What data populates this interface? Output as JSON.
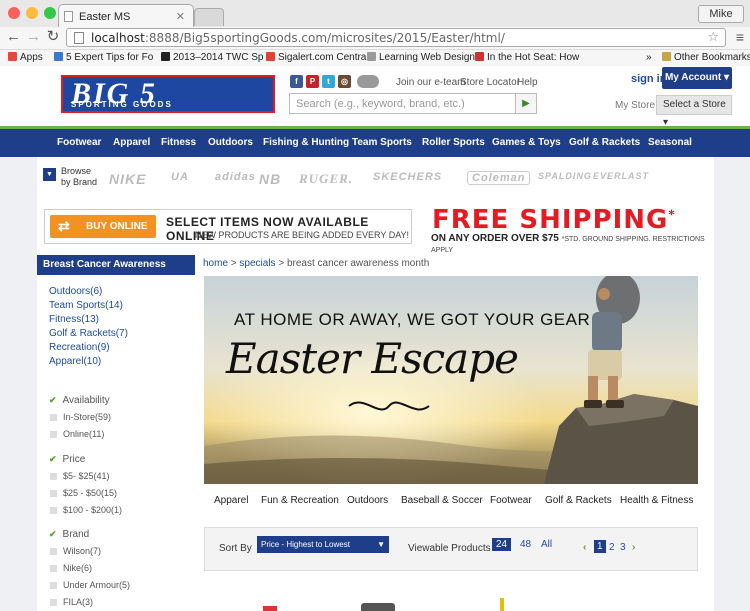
{
  "browser": {
    "tab_title": "Easter MS",
    "user": "Mike",
    "url_host": "localhost",
    "url_rest": ":8888/Big5sportingGoods.com/microsites/2015/Easter/html/",
    "bookmarks": [
      "Apps",
      "5 Expert Tips for Fo",
      "2013–2014 TWC Sp",
      "Sigalert.com Central",
      "Learning Web Design",
      "In the Hot Seat: How",
      "»",
      "Other Bookmarks"
    ]
  },
  "header": {
    "logo_main": "BIG 5",
    "logo_sub": "SPORTING GOODS",
    "links": [
      "Join our e-team",
      "Store Locator",
      "Help"
    ],
    "search_placeholder": "Search (e.g., keyword, brand, etc.)",
    "signin": "sign in",
    "my_account": "My Account ▾",
    "my_store": "My Store",
    "select_store": "Select a Store ▾"
  },
  "nav": [
    "Footwear",
    "Apparel",
    "Fitness",
    "Outdoors",
    "Fishing & Hunting",
    "Team Sports",
    "Roller Sports",
    "Games & Toys",
    "Golf & Rackets",
    "Seasonal"
  ],
  "brands": {
    "label_1": "Browse",
    "label_2": "by Brand",
    "items": [
      "NIKE",
      "UA",
      "adidas",
      "NB",
      "RUGER.",
      "SKECHERS",
      "Coleman",
      "SPALDING",
      "EVERLAST"
    ]
  },
  "promo": {
    "buy_online": "BUY ONLINE",
    "headline": "SELECT ITEMS NOW AVAILABLE ONLINE",
    "subline": "NEW PRODUCTS ARE BEING ADDED EVERY DAY!",
    "free_shipping": "FREE SHIPPING",
    "shipping_sub": "ON ANY ORDER OVER $75",
    "shipping_note": "*STD. GROUND SHIPPING. RESTRICTIONS APPLY"
  },
  "sidebar": {
    "title": "Breast Cancer Awareness Month",
    "categories": [
      "Outdoors(6)",
      "Team Sports(14)",
      "Fitness(13)",
      "Golf & Rackets(7)",
      "Recreation(9)",
      "Apparel(10)"
    ],
    "availability": {
      "title": "Availability",
      "options": [
        "In-Store(59)",
        "Online(11)"
      ]
    },
    "price": {
      "title": "Price",
      "options": [
        "$5- $25(41)",
        "$25 - $50(15)",
        "$100 - $200(1)"
      ]
    },
    "brand": {
      "title": "Brand",
      "options": [
        "Wilson(7)",
        "Nike(6)",
        "Under Armour(5)",
        "FILA(3)"
      ]
    }
  },
  "breadcrumb": {
    "home": "home",
    "sep": ">",
    "specials": "specials",
    "current": "breast cancer awareness month"
  },
  "hero": {
    "tagline": "AT HOME OR AWAY, WE GOT YOUR GEAR",
    "title": "Easter Escape"
  },
  "subcategories": [
    "Apparel",
    "Fun & Recreation",
    "Outdoors",
    "Baseball & Soccer",
    "Footwear",
    "Golf & Rackets",
    "Health & Fitness"
  ],
  "sort": {
    "label": "Sort By",
    "selected": "Price - Highest to Lowest",
    "viewable_label": "Viewable Products",
    "view_options": [
      "24",
      "48",
      "All"
    ],
    "pages": [
      "1",
      "2",
      "3"
    ]
  },
  "colors": {
    "brand_blue": "#1f3e8a",
    "brand_red": "#e31b23",
    "accent_green": "#6ab04c"
  }
}
